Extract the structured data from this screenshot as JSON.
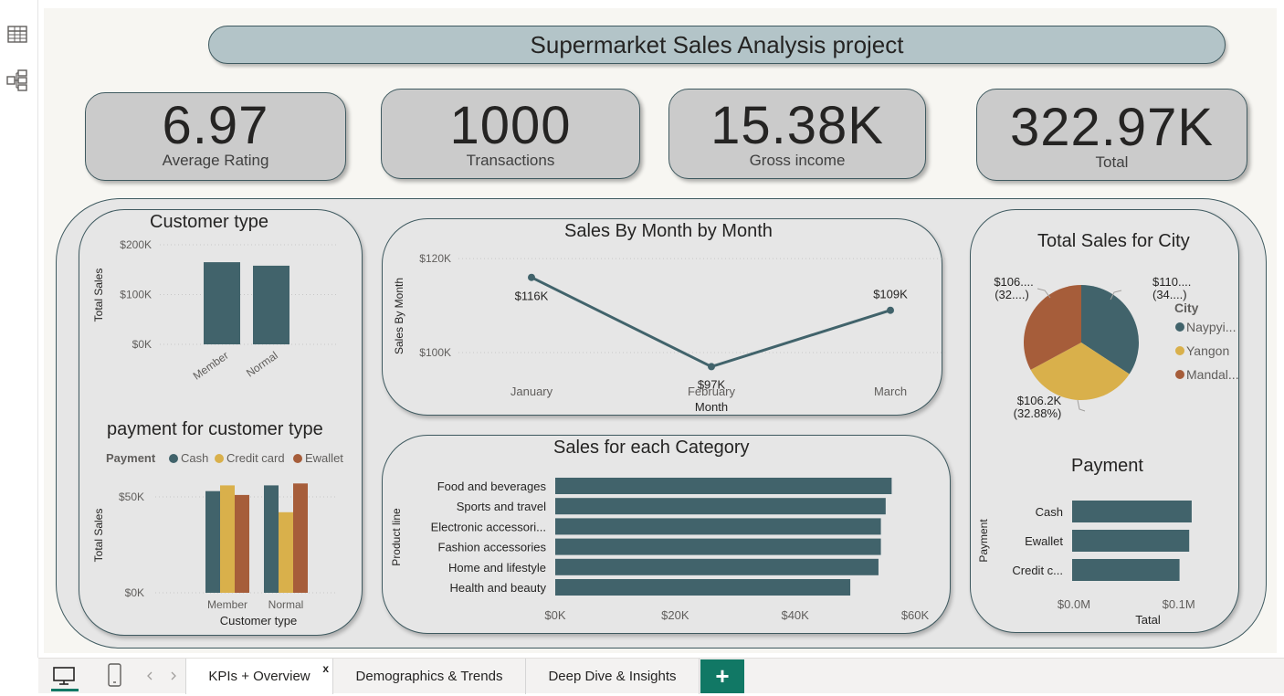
{
  "title": "Supermarket Sales Analysis project",
  "kpis": [
    {
      "value": "6.97",
      "label": "Average Rating"
    },
    {
      "value": "1000",
      "label": "Transactions"
    },
    {
      "value": "15.38K",
      "label": "Gross income"
    },
    {
      "value": "322.97K",
      "label": "Total"
    }
  ],
  "visuals": {
    "customer_type": {
      "title": "Customer type"
    },
    "payment_customer": {
      "title": "payment for customer type"
    },
    "sales_month": {
      "title": "Sales By Month by Month"
    },
    "category": {
      "title": "Sales for each Category"
    },
    "city": {
      "title": "Total Sales for City"
    },
    "payment": {
      "title": "Payment"
    }
  },
  "tabs": [
    {
      "label": "KPIs + Overview",
      "close": "x"
    },
    {
      "label": "Demographics & Trends"
    },
    {
      "label": "Deep Dive & Insights"
    }
  ],
  "add_tab_label": "+",
  "colors": {
    "teal": "#41636b",
    "gold": "#d9b04b",
    "rust": "#a65d3a"
  },
  "chart_data": [
    {
      "type": "bar",
      "title": "Customer type",
      "categories": [
        "Member",
        "Normal"
      ],
      "values": [
        165000,
        158000
      ],
      "xlabel": "",
      "ylabel": "Total Sales",
      "ylim": [
        0,
        200000
      ],
      "ticks": [
        "$0K",
        "$100K",
        "$200K"
      ]
    },
    {
      "type": "bar",
      "title": "payment for customer type",
      "legend_title": "Payment",
      "categories": [
        "Member",
        "Normal"
      ],
      "series": [
        {
          "name": "Cash",
          "values": [
            53000,
            56000
          ]
        },
        {
          "name": "Credit card",
          "values": [
            56000,
            42000
          ]
        },
        {
          "name": "Ewallet",
          "values": [
            51000,
            57000
          ]
        }
      ],
      "xlabel": "Customer type",
      "ylabel": "Total Sales",
      "ylim": [
        0,
        60000
      ],
      "ticks": [
        "$0K",
        "$50K"
      ]
    },
    {
      "type": "line",
      "title": "Sales By Month by Month",
      "categories": [
        "January",
        "February",
        "March"
      ],
      "values": [
        116000,
        97000,
        109000
      ],
      "labels": [
        "$116K",
        "$97K",
        "$109K"
      ],
      "xlabel": "Month",
      "ylabel": "Sales By Month",
      "ylim": [
        93000,
        121000
      ],
      "ticks": [
        "$100K",
        "$120K"
      ]
    },
    {
      "type": "bar",
      "orientation": "horizontal",
      "title": "Sales for each Category",
      "categories": [
        "Food and beverages",
        "Sports and travel",
        "Electronic accessori...",
        "Fashion accessories",
        "Home and lifestyle",
        "Health and beauty"
      ],
      "values": [
        56100,
        55100,
        54300,
        54300,
        53900,
        49200
      ],
      "xlabel": "",
      "ylabel": "Product line",
      "xlim": [
        0,
        60000
      ],
      "ticks": [
        "$0K",
        "$20K",
        "$40K",
        "$60K"
      ]
    },
    {
      "type": "pie",
      "title": "Total Sales for City",
      "legend_title": "City",
      "slices": [
        {
          "name": "Naypyi...",
          "value": 110600,
          "label": "$110....",
          "pct": "(34....)"
        },
        {
          "name": "Yangon",
          "value": 106200,
          "label": "$106.2K",
          "pct": "(32.88%)"
        },
        {
          "name": "Mandal...",
          "value": 106200,
          "label": "$106....",
          "pct": "(32....)"
        }
      ]
    },
    {
      "type": "bar",
      "orientation": "horizontal",
      "title": "Payment",
      "categories": [
        "Cash",
        "Ewallet",
        "Credit c..."
      ],
      "values": [
        112200,
        109900,
        100800
      ],
      "xlabel": "Tatal",
      "ylabel": "Payment",
      "xlim": [
        0,
        120000
      ],
      "ticks": [
        "$0.0M",
        "$0.1M"
      ]
    }
  ]
}
